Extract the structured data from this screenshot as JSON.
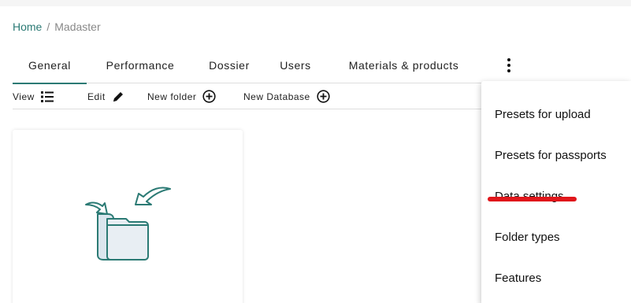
{
  "breadcrumb": {
    "home": "Home",
    "separator": "/",
    "current": "Madaster"
  },
  "tabs": [
    {
      "label": "General",
      "active": true
    },
    {
      "label": "Performance",
      "active": false
    },
    {
      "label": "Dossier",
      "active": false
    },
    {
      "label": "Users",
      "active": false
    },
    {
      "label": "Materials & products",
      "active": false
    }
  ],
  "more_menu_icon": "kebab-vertical-icon",
  "toolbar": {
    "view_label": "View",
    "view_icon": "list-icon",
    "edit_label": "Edit",
    "edit_icon": "pencil-icon",
    "new_folder_label": "New folder",
    "new_folder_icon": "plus-circle-icon",
    "new_database_label": "New Database",
    "new_database_icon": "plus-circle-icon"
  },
  "card": {
    "icon": "folder-import-icon"
  },
  "menu": {
    "items": [
      {
        "label": "Presets for upload"
      },
      {
        "label": "Presets for passports"
      },
      {
        "label": "Data settings",
        "highlighted": true
      },
      {
        "label": "Folder types"
      },
      {
        "label": "Features"
      }
    ]
  },
  "colors": {
    "accent": "#2b7a74",
    "highlight_mark": "#e0161b",
    "icon_fill": "#e8eef3"
  }
}
